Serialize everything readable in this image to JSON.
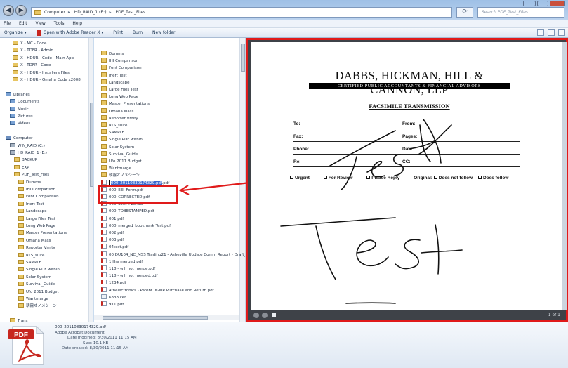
{
  "window": {
    "address_crumbs": [
      "Computer",
      "HD_RAID_1 (E:)",
      "PDF_Test_Files"
    ],
    "search_placeholder": "Search PDF_Test_Files"
  },
  "menu": [
    "File",
    "Edit",
    "View",
    "Tools",
    "Help"
  ],
  "toolbar": {
    "organize": "Organize ▾",
    "open_with": "Open with Adobe Reader X ▾",
    "print": "Print",
    "burn": "Burn",
    "new_folder": "New folder"
  },
  "left_tree": [
    {
      "label": "X - MC - Code",
      "icon": "folder"
    },
    {
      "label": "X - TDFR - Admin",
      "icon": "folder"
    },
    {
      "label": "X - HDUR - Code - Main App",
      "icon": "folder"
    },
    {
      "label": "X - TDFR - Code",
      "icon": "folder"
    },
    {
      "label": "X - HDUR - Installers Files",
      "icon": "folder"
    },
    {
      "label": "X - HDUR - Omaha Code x2008",
      "icon": "folder"
    },
    {
      "label": "",
      "icon": "none"
    },
    {
      "label": "Libraries",
      "icon": "lib"
    },
    {
      "label": "Documents",
      "icon": "lib"
    },
    {
      "label": "Music",
      "icon": "lib"
    },
    {
      "label": "Pictures",
      "icon": "lib"
    },
    {
      "label": "Videos",
      "icon": "lib"
    },
    {
      "label": "",
      "icon": "none"
    },
    {
      "label": "Computer",
      "icon": "comp"
    },
    {
      "label": "WIN_RAID (C:)",
      "icon": "drive"
    },
    {
      "label": "HD_RAID_1 (E:)",
      "icon": "drive"
    },
    {
      "label": "BACKUP",
      "icon": "folder"
    },
    {
      "label": "EXP",
      "icon": "folder"
    },
    {
      "label": "PDF_Test_Files",
      "icon": "folder"
    },
    {
      "label": "Dumms",
      "icon": "folder"
    },
    {
      "label": "IHI Comparison",
      "icon": "folder"
    },
    {
      "label": "Font Comparison",
      "icon": "folder"
    },
    {
      "label": "Inert Test",
      "icon": "folder"
    },
    {
      "label": "Landscape",
      "icon": "folder"
    },
    {
      "label": "Large Files Test",
      "icon": "folder"
    },
    {
      "label": "Long Web Page",
      "icon": "folder"
    },
    {
      "label": "Master Presentations",
      "icon": "folder"
    },
    {
      "label": "Omaha Mass",
      "icon": "folder"
    },
    {
      "label": "Reporter Vmity",
      "icon": "folder"
    },
    {
      "label": "RTS_suite",
      "icon": "folder"
    },
    {
      "label": "SAMPLE",
      "icon": "folder"
    },
    {
      "label": "Single PDF within",
      "icon": "folder"
    },
    {
      "label": "Solar System",
      "icon": "folder"
    },
    {
      "label": "Survival_Guide",
      "icon": "folder"
    },
    {
      "label": "Ufo 2011 Budget",
      "icon": "folder"
    },
    {
      "label": "Wantmarge",
      "icon": "folder"
    },
    {
      "label": "朝霧オノメシーン",
      "icon": "folder"
    },
    {
      "label": "",
      "icon": "none"
    },
    {
      "label": "Trans",
      "icon": "folder"
    }
  ],
  "file_list": [
    {
      "label": "Dumms",
      "icon": "folder"
    },
    {
      "label": "IHI Comparison",
      "icon": "folder"
    },
    {
      "label": "Font Comparison",
      "icon": "folder"
    },
    {
      "label": "Inert Test",
      "icon": "folder"
    },
    {
      "label": "Landscape",
      "icon": "folder"
    },
    {
      "label": "Large Files Test",
      "icon": "folder"
    },
    {
      "label": "Long Web Page",
      "icon": "folder"
    },
    {
      "label": "Master Presentations",
      "icon": "folder"
    },
    {
      "label": "Omaha Mass",
      "icon": "folder"
    },
    {
      "label": "Reporter Vmity",
      "icon": "folder"
    },
    {
      "label": "RTS_suite",
      "icon": "folder"
    },
    {
      "label": "SAMPLE",
      "icon": "folder"
    },
    {
      "label": "Single PDF within",
      "icon": "folder"
    },
    {
      "label": "Solar System",
      "icon": "folder"
    },
    {
      "label": "Survival_Guide",
      "icon": "folder"
    },
    {
      "label": "Ufo 2011 Budget",
      "icon": "folder"
    },
    {
      "label": "Wantmarge",
      "icon": "folder"
    },
    {
      "label": "朝霧オノメシーン",
      "icon": "folder"
    },
    {
      "label": "000_EEI_Form.pdf",
      "icon": "pdf"
    },
    {
      "label": "000_CORRECTED.pdf",
      "icon": "pdf"
    },
    {
      "label": "000_STAMPED.pdf",
      "icon": "pdf"
    },
    {
      "label": "000_TOBESTAMPED.pdf",
      "icon": "pdf"
    },
    {
      "label": "001.pdf",
      "icon": "pdf"
    },
    {
      "label": "000_merged_bookmark Test.pdf",
      "icon": "pdf"
    },
    {
      "label": "002.pdf",
      "icon": "pdf"
    },
    {
      "label": "003.pdf",
      "icon": "pdf"
    },
    {
      "label": "04test.pdf",
      "icon": "pdf"
    },
    {
      "label": "00 DU104_NC_MSS Trading21 - Asheville Update Comm Report - Draft_6.pdf",
      "icon": "pdf"
    },
    {
      "label": "1 Hrs merged.pdf",
      "icon": "pdf"
    },
    {
      "label": "118 - will not merge.pdf",
      "icon": "pdf"
    },
    {
      "label": "118 - will not merged.pdf",
      "icon": "pdf"
    },
    {
      "label": "1234.pdf",
      "icon": "pdf"
    },
    {
      "label": "4thelectronics - Parent IN-MR Purchase and Return.pdf",
      "icon": "pdf"
    },
    {
      "label": "6338.cer",
      "icon": "file"
    },
    {
      "label": "911.pdf",
      "icon": "pdf"
    }
  ],
  "rename": {
    "selected_text": "000_20110830174329.pdf",
    "suffix": ".pdf"
  },
  "preview": {
    "firm_name": "DABBS, HICKMAN, HILL & CANNON, LLP",
    "firm_subtitle": "CERTIFIED PUBLIC ACCOUNTANTS & FINANCIAL ADVISORS",
    "fax_title": "FACSIMILE TRANSMISSION",
    "labels": {
      "to": "To:",
      "from": "From:",
      "fax": "Fax:",
      "pages": "Pages:",
      "phone": "Phone:",
      "date": "Date:",
      "re": "Re:",
      "cc": "CC:"
    },
    "checkboxes": {
      "urgent": "Urgent",
      "for_review": "For Review",
      "please_reply": "Please Reply",
      "original": "Original:",
      "not_follow": "Does not follow",
      "will_follow": "Does follow"
    },
    "page_count": "1 of 1"
  },
  "details": {
    "filename": "000_20110830174329.pdf",
    "type": "Adobe Acrobat Document",
    "date_modified": "Date modified: 8/30/2011 11:15 AM",
    "size": "Size: 10.1 KB",
    "date_created": "Date created: 8/30/2011 11:15 AM"
  },
  "colors": {
    "highlight": "#e01a1a",
    "pdf_red": "#c7271f",
    "folder_yellow": "#e8c663"
  }
}
